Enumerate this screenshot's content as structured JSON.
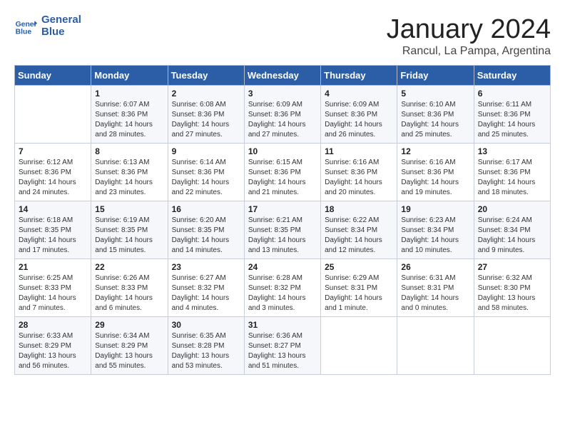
{
  "header": {
    "logo_line1": "General",
    "logo_line2": "Blue",
    "month": "January 2024",
    "location": "Rancul, La Pampa, Argentina"
  },
  "weekdays": [
    "Sunday",
    "Monday",
    "Tuesday",
    "Wednesday",
    "Thursday",
    "Friday",
    "Saturday"
  ],
  "weeks": [
    [
      {
        "day": "",
        "info": ""
      },
      {
        "day": "1",
        "info": "Sunrise: 6:07 AM\nSunset: 8:36 PM\nDaylight: 14 hours\nand 28 minutes."
      },
      {
        "day": "2",
        "info": "Sunrise: 6:08 AM\nSunset: 8:36 PM\nDaylight: 14 hours\nand 27 minutes."
      },
      {
        "day": "3",
        "info": "Sunrise: 6:09 AM\nSunset: 8:36 PM\nDaylight: 14 hours\nand 27 minutes."
      },
      {
        "day": "4",
        "info": "Sunrise: 6:09 AM\nSunset: 8:36 PM\nDaylight: 14 hours\nand 26 minutes."
      },
      {
        "day": "5",
        "info": "Sunrise: 6:10 AM\nSunset: 8:36 PM\nDaylight: 14 hours\nand 25 minutes."
      },
      {
        "day": "6",
        "info": "Sunrise: 6:11 AM\nSunset: 8:36 PM\nDaylight: 14 hours\nand 25 minutes."
      }
    ],
    [
      {
        "day": "7",
        "info": "Sunrise: 6:12 AM\nSunset: 8:36 PM\nDaylight: 14 hours\nand 24 minutes."
      },
      {
        "day": "8",
        "info": "Sunrise: 6:13 AM\nSunset: 8:36 PM\nDaylight: 14 hours\nand 23 minutes."
      },
      {
        "day": "9",
        "info": "Sunrise: 6:14 AM\nSunset: 8:36 PM\nDaylight: 14 hours\nand 22 minutes."
      },
      {
        "day": "10",
        "info": "Sunrise: 6:15 AM\nSunset: 8:36 PM\nDaylight: 14 hours\nand 21 minutes."
      },
      {
        "day": "11",
        "info": "Sunrise: 6:16 AM\nSunset: 8:36 PM\nDaylight: 14 hours\nand 20 minutes."
      },
      {
        "day": "12",
        "info": "Sunrise: 6:16 AM\nSunset: 8:36 PM\nDaylight: 14 hours\nand 19 minutes."
      },
      {
        "day": "13",
        "info": "Sunrise: 6:17 AM\nSunset: 8:36 PM\nDaylight: 14 hours\nand 18 minutes."
      }
    ],
    [
      {
        "day": "14",
        "info": "Sunrise: 6:18 AM\nSunset: 8:35 PM\nDaylight: 14 hours\nand 17 minutes."
      },
      {
        "day": "15",
        "info": "Sunrise: 6:19 AM\nSunset: 8:35 PM\nDaylight: 14 hours\nand 15 minutes."
      },
      {
        "day": "16",
        "info": "Sunrise: 6:20 AM\nSunset: 8:35 PM\nDaylight: 14 hours\nand 14 minutes."
      },
      {
        "day": "17",
        "info": "Sunrise: 6:21 AM\nSunset: 8:35 PM\nDaylight: 14 hours\nand 13 minutes."
      },
      {
        "day": "18",
        "info": "Sunrise: 6:22 AM\nSunset: 8:34 PM\nDaylight: 14 hours\nand 12 minutes."
      },
      {
        "day": "19",
        "info": "Sunrise: 6:23 AM\nSunset: 8:34 PM\nDaylight: 14 hours\nand 10 minutes."
      },
      {
        "day": "20",
        "info": "Sunrise: 6:24 AM\nSunset: 8:34 PM\nDaylight: 14 hours\nand 9 minutes."
      }
    ],
    [
      {
        "day": "21",
        "info": "Sunrise: 6:25 AM\nSunset: 8:33 PM\nDaylight: 14 hours\nand 7 minutes."
      },
      {
        "day": "22",
        "info": "Sunrise: 6:26 AM\nSunset: 8:33 PM\nDaylight: 14 hours\nand 6 minutes."
      },
      {
        "day": "23",
        "info": "Sunrise: 6:27 AM\nSunset: 8:32 PM\nDaylight: 14 hours\nand 4 minutes."
      },
      {
        "day": "24",
        "info": "Sunrise: 6:28 AM\nSunset: 8:32 PM\nDaylight: 14 hours\nand 3 minutes."
      },
      {
        "day": "25",
        "info": "Sunrise: 6:29 AM\nSunset: 8:31 PM\nDaylight: 14 hours\nand 1 minute."
      },
      {
        "day": "26",
        "info": "Sunrise: 6:31 AM\nSunset: 8:31 PM\nDaylight: 14 hours\nand 0 minutes."
      },
      {
        "day": "27",
        "info": "Sunrise: 6:32 AM\nSunset: 8:30 PM\nDaylight: 13 hours\nand 58 minutes."
      }
    ],
    [
      {
        "day": "28",
        "info": "Sunrise: 6:33 AM\nSunset: 8:29 PM\nDaylight: 13 hours\nand 56 minutes."
      },
      {
        "day": "29",
        "info": "Sunrise: 6:34 AM\nSunset: 8:29 PM\nDaylight: 13 hours\nand 55 minutes."
      },
      {
        "day": "30",
        "info": "Sunrise: 6:35 AM\nSunset: 8:28 PM\nDaylight: 13 hours\nand 53 minutes."
      },
      {
        "day": "31",
        "info": "Sunrise: 6:36 AM\nSunset: 8:27 PM\nDaylight: 13 hours\nand 51 minutes."
      },
      {
        "day": "",
        "info": ""
      },
      {
        "day": "",
        "info": ""
      },
      {
        "day": "",
        "info": ""
      }
    ]
  ]
}
